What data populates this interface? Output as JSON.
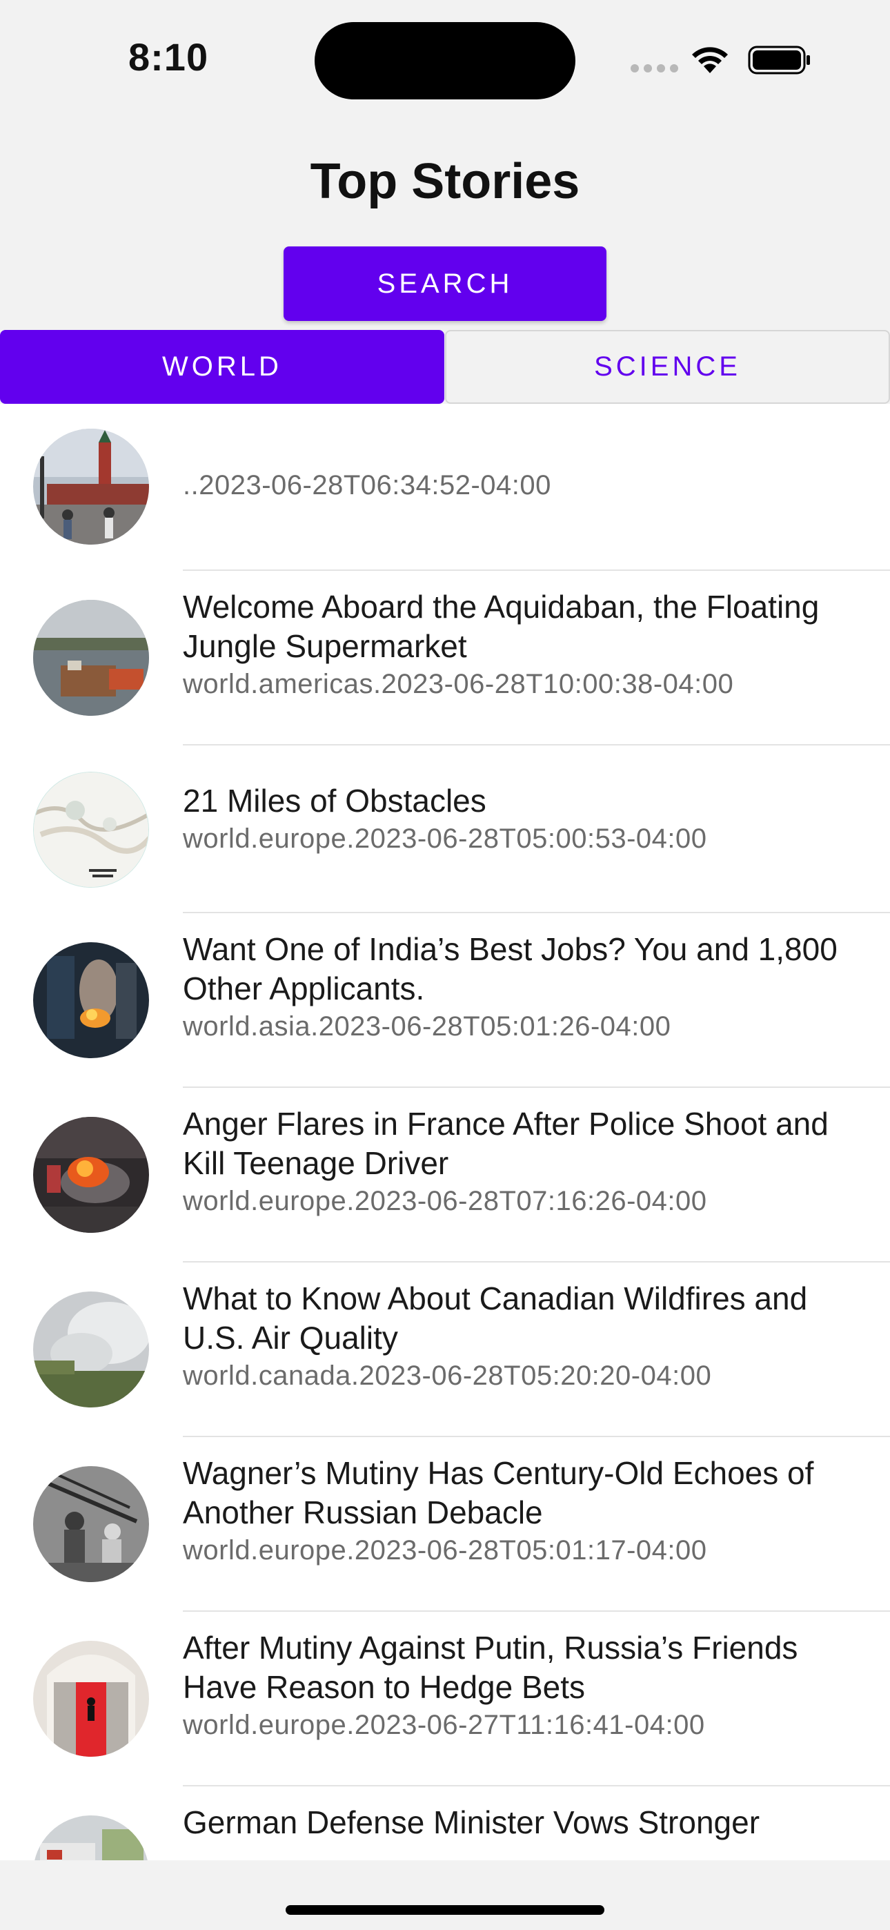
{
  "status_bar": {
    "time": "8:10",
    "icons": [
      "cellular-signal-icon",
      "wifi-icon",
      "battery-icon"
    ]
  },
  "header": {
    "title": "Top Stories",
    "search_label": "SEARCH"
  },
  "tabs": [
    {
      "label": "WORLD",
      "selected": true
    },
    {
      "label": "SCIENCE",
      "selected": false
    }
  ],
  "colors": {
    "accent": "#6200ee",
    "background": "#f2f2f2",
    "meta_text": "#6b6b6b"
  },
  "stories": [
    {
      "title": "",
      "meta": "..2023-06-28T06:34:52-04:00"
    },
    {
      "title": "Welcome Aboard the Aquidaban, the Floating Jungle Supermarket",
      "meta": "world.americas.2023-06-28T10:00:38-04:00"
    },
    {
      "title": "21 Miles of Obstacles",
      "meta": "world.europe.2023-06-28T05:00:53-04:00"
    },
    {
      "title": "Want One of India’s Best Jobs? You and 1,800 Other Applicants.",
      "meta": "world.asia.2023-06-28T05:01:26-04:00"
    },
    {
      "title": "Anger Flares in France After Police Shoot and Kill Teenage Driver",
      "meta": "world.europe.2023-06-28T07:16:26-04:00"
    },
    {
      "title": "What to Know About Canadian Wildfires and U.S. Air Quality",
      "meta": "world.canada.2023-06-28T05:20:20-04:00"
    },
    {
      "title": "Wagner’s Mutiny Has Century-Old Echoes of Another Russian Debacle",
      "meta": "world.europe.2023-06-28T05:01:17-04:00"
    },
    {
      "title": "After Mutiny Against Putin, Russia’s Friends Have Reason to Hedge Bets",
      "meta": "world.europe.2023-06-27T11:16:41-04:00"
    },
    {
      "title": "German Defense Minister Vows Stronger",
      "meta": ""
    }
  ]
}
